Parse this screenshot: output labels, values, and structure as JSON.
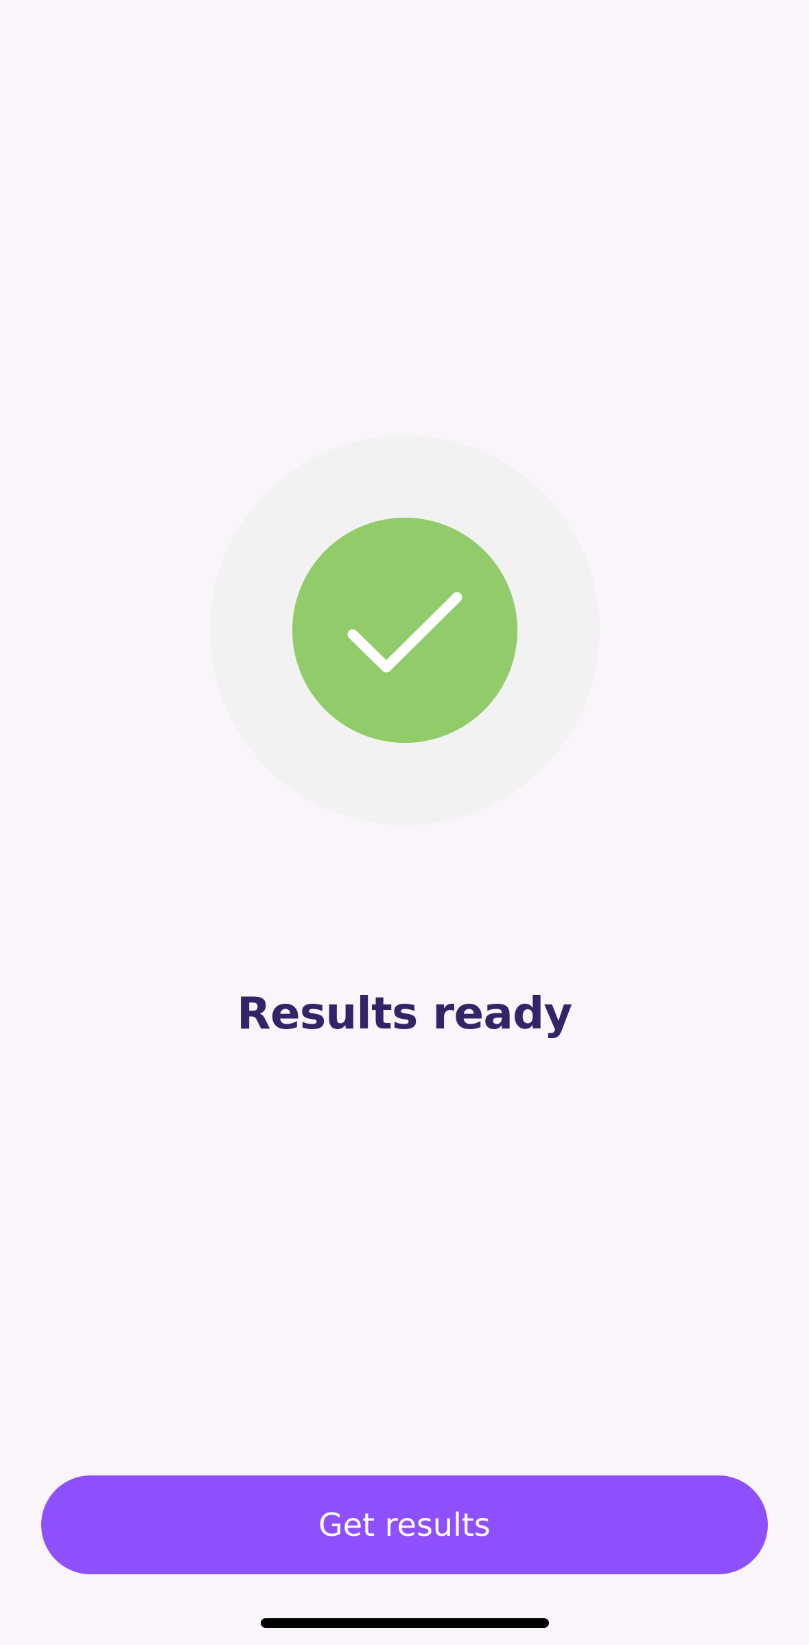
{
  "status": {
    "icon": "checkmark-icon",
    "outer_color": "#f2f2f2",
    "inner_color": "#91cb6a"
  },
  "main": {
    "title": "Results ready"
  },
  "actions": {
    "primary_label": "Get results",
    "primary_color": "#8e4ffc"
  },
  "colors": {
    "background": "#faf5fa",
    "title": "#312467"
  }
}
